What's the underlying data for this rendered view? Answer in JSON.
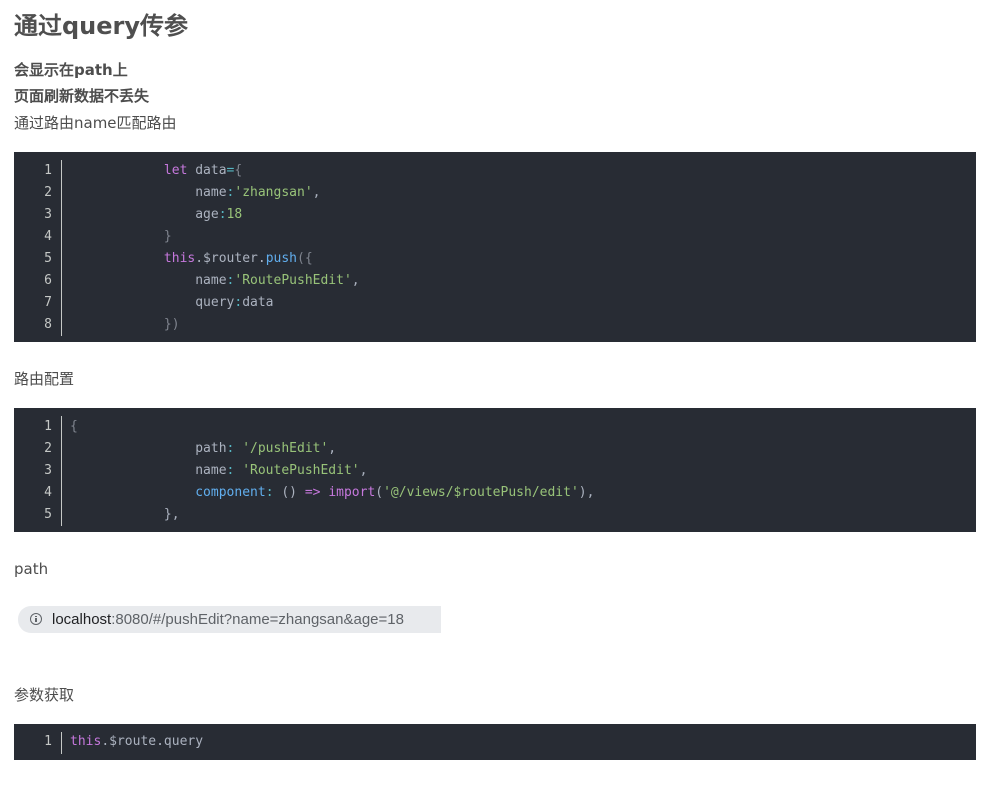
{
  "heading": "通过query传参",
  "notes": {
    "line1": "会显示在path上",
    "line2": "页面刷新数据不丢失",
    "line3": "通过路由name匹配路由"
  },
  "section_route_config": "路由配置",
  "section_path": "path",
  "section_get_params": "参数获取",
  "url_bar": {
    "host": "localhost",
    "rest": ":8080/#/pushEdit?name=zhangsan&age=18"
  },
  "code_block_1": {
    "line_numbers": [
      "1",
      "2",
      "3",
      "4",
      "5",
      "6",
      "7",
      "8"
    ],
    "lines": [
      "            let data={",
      "                name:'zhangsan',",
      "                age:18",
      "            }",
      "            this.$router.push({",
      "                name:'RoutePushEdit',",
      "                query:data",
      "            })"
    ]
  },
  "code_block_2": {
    "line_numbers": [
      "1",
      "2",
      "3",
      "4",
      "5"
    ],
    "lines": [
      "{",
      "                path: '/pushEdit',",
      "                name: 'RoutePushEdit',",
      "                component: () => import('@/views/$routePush/edit'),",
      "            },"
    ]
  },
  "code_block_3": {
    "line_numbers": [
      "1"
    ],
    "lines": [
      "this.$route.query"
    ]
  },
  "colors": {
    "code_bg": "#282c34",
    "keyword": "#c678dd",
    "string": "#98c379",
    "number": "#d19a66",
    "function": "#61aeee",
    "plain": "#abb2bf"
  }
}
